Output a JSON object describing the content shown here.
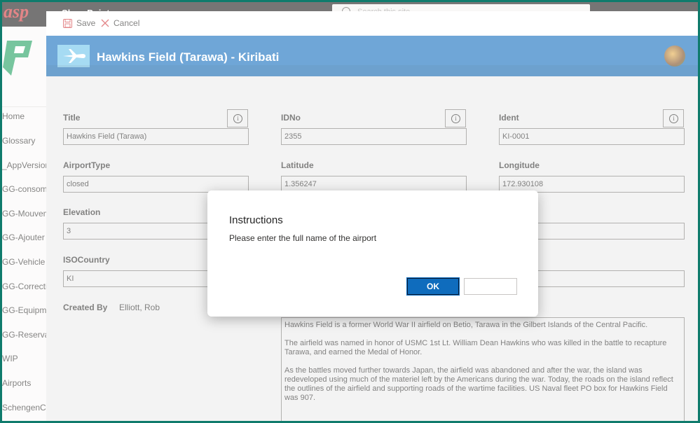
{
  "topbar": {
    "brand": "asp",
    "app_title": "SharePoint",
    "search_placeholder": "Search this site"
  },
  "nav": {
    "items": [
      {
        "label": "Home"
      },
      {
        "label": "Glossary"
      },
      {
        "label": "_AppVersions"
      },
      {
        "label": "GG-consommations"
      },
      {
        "label": "GG-Mouvements"
      },
      {
        "label": "GG-Ajouter"
      },
      {
        "label": "GG-Vehicle Info"
      },
      {
        "label": "GG-Correctives"
      },
      {
        "label": "GG-Equipments"
      },
      {
        "label": "GG-Reservations"
      },
      {
        "label": "WIP"
      },
      {
        "label": "Airports"
      },
      {
        "label": "SchengenCalc"
      }
    ]
  },
  "commandbar": {
    "save_label": "Save",
    "cancel_label": "Cancel"
  },
  "header": {
    "title": "Hawkins Field (Tarawa) - Kiribati",
    "accent": "#0f6cbd"
  },
  "form": {
    "title": {
      "label": "Title",
      "value": "Hawkins Field (Tarawa)"
    },
    "idno": {
      "label": "IDNo",
      "value": "2355"
    },
    "ident": {
      "label": "Ident",
      "value": "KI-0001"
    },
    "airporttype": {
      "label": "AirportType",
      "value": "closed"
    },
    "latitude": {
      "label": "Latitude",
      "value": "1.356247"
    },
    "longitude": {
      "label": "Longitude",
      "value": "172.930108"
    },
    "elevation": {
      "label": "Elevation",
      "value": "3"
    },
    "isocountry": {
      "label": "ISOCountry",
      "value": "KI"
    },
    "created_by": {
      "label": "Created By",
      "value": "Elliott, Rob"
    },
    "description": [
      "Hawkins Field is a former World War II airfield on Betio, Tarawa in the Gilbert Islands of the Central Pacific.",
      "The airfield was named in honor of USMC 1st Lt. William Dean Hawkins who was killed in the battle to recapture Tarawa, and earned the Medal of Honor.",
      "As the battles moved further towards Japan, the airfield was abandoned and after the war, the island was redeveloped using much of the materiel left by the Americans during the war. Today, the roads on the island reflect the outlines of the airfield and supporting roads of the wartime facilities. US Naval fleet PO box for Hawkins Field was 907."
    ]
  },
  "dialog": {
    "title": "Instructions",
    "message": "Please enter the full name of the airport",
    "ok_label": "OK",
    "secondary_label": ""
  }
}
